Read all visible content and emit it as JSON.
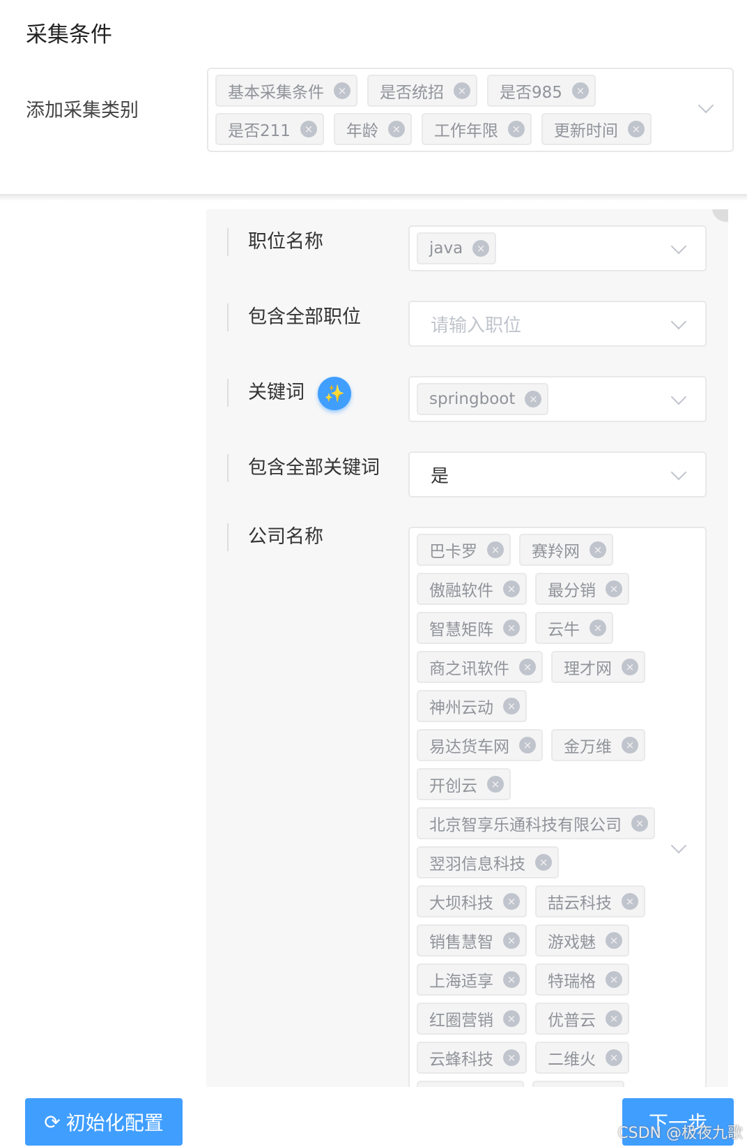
{
  "title": "采集条件",
  "category": {
    "label": "添加采集类别",
    "tags": [
      "基本采集条件",
      "是否统招",
      "是否985",
      "是否211",
      "年龄",
      "工作年限",
      "更新时间"
    ]
  },
  "form": {
    "position_name": {
      "label": "职位名称",
      "tags": [
        "java"
      ]
    },
    "include_all_positions": {
      "label": "包含全部职位",
      "placeholder": "请输入职位"
    },
    "keywords": {
      "label": "关键词",
      "tags": [
        "springboot"
      ],
      "icon": "magic-wand-icon"
    },
    "include_all_keywords": {
      "label": "包含全部关键词",
      "value": "是"
    },
    "company": {
      "label": "公司名称",
      "rows": [
        [
          "巴卡罗",
          "赛羚网"
        ],
        [
          "傲融软件",
          "最分销"
        ],
        [
          "智慧矩阵",
          "云牛"
        ],
        [
          "商之讯软件",
          "理才网"
        ],
        [
          "神州云动"
        ],
        [
          "易达货车网",
          "金万维"
        ],
        [
          "开创云"
        ],
        [
          "北京智享乐通科技有限公司"
        ],
        [
          "翌羽信息科技"
        ],
        [
          "大坝科技",
          "喆云科技"
        ],
        [
          "销售慧智",
          "游戏魅"
        ],
        [
          "上海适享",
          "特瑞格"
        ],
        [
          "红圈营销",
          "优普云"
        ],
        [
          "云蜂科技",
          "二维火"
        ]
      ]
    }
  },
  "buttons": {
    "init": "初始化配置",
    "next": "下一步"
  },
  "watermark": "CSDN @极夜九歌",
  "colors": {
    "primary": "#409eff",
    "tag_bg": "#f4f4f5"
  }
}
